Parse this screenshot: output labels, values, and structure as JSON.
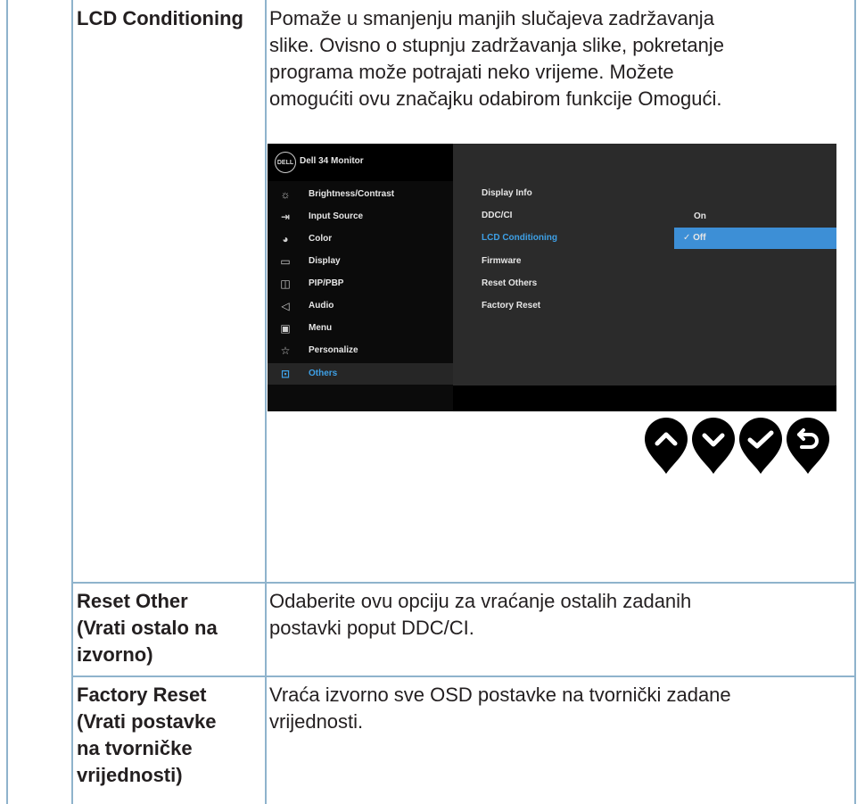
{
  "rows": [
    {
      "label": "LCD Conditioning",
      "text": "Pomaže u smanjenju manjih slučajeva zadržavanja slike. Ovisno o stupnju zadržavanja slike, pokretanje programa može potrajati neko vrijeme. Možete omogućiti ovu značajku odabirom funkcije Omogući.",
      "text_lines": [
        "Pomaže u smanjenju manjih slučajeva zadržavanja",
        "slike. Ovisno o stupnju zadržavanja slike, pokretanje",
        "programa može potrajati neko vrijeme. Možete",
        "omogućiti ovu značajku odabirom funkcije Omogući."
      ]
    },
    {
      "label": "Reset Other (Vrati ostalo na izvorno)",
      "label_lines": [
        "Reset Other",
        "(Vrati ostalo na",
        "izvorno)"
      ],
      "text": "Odaberite ovu opciju za vraćanje ostalih zadanih postavki poput DDC/CI.",
      "text_lines": [
        "Odaberite ovu opciju za vraćanje ostalih zadanih",
        "postavki poput DDC/CI."
      ]
    },
    {
      "label": "Factory Reset (Vrati postavke na tvorničke vrijednosti)",
      "label_lines": [
        "Factory Reset",
        "(Vrati postavke",
        "na tvorničke",
        "vrijednosti)"
      ],
      "text": "Vraća izvorno sve OSD postavke na tvornički zadane vrijednosti.",
      "text_lines": [
        "Vraća izvorno sve OSD postavke na tvornički zadane",
        "vrijednosti."
      ]
    }
  ],
  "osd": {
    "logo_text": "DELL",
    "title": "Dell 34 Monitor",
    "menu": [
      {
        "label": "Brightness/Contrast",
        "icon": "sun-icon"
      },
      {
        "label": "Input Source",
        "icon": "input-source-icon"
      },
      {
        "label": "Color",
        "icon": "palette-icon"
      },
      {
        "label": "Display",
        "icon": "display-icon"
      },
      {
        "label": "PIP/PBP",
        "icon": "pip-icon"
      },
      {
        "label": "Audio",
        "icon": "speaker-icon"
      },
      {
        "label": "Menu",
        "icon": "menu-icon"
      },
      {
        "label": "Personalize",
        "icon": "star-icon"
      },
      {
        "label": "Others",
        "icon": "others-icon",
        "active": true
      }
    ],
    "submenu": [
      "Display Info",
      "DDC/CI",
      "LCD Conditioning",
      "Firmware",
      "Reset Others",
      "Factory Reset"
    ],
    "submenu_active": "LCD Conditioning",
    "options": [
      {
        "label": "On",
        "selected": false
      },
      {
        "label": "✓ Off",
        "selected": true
      }
    ],
    "accent_color": "#3d8fd6"
  },
  "nav_buttons": [
    "up-icon",
    "down-icon",
    "check-icon",
    "back-icon"
  ]
}
